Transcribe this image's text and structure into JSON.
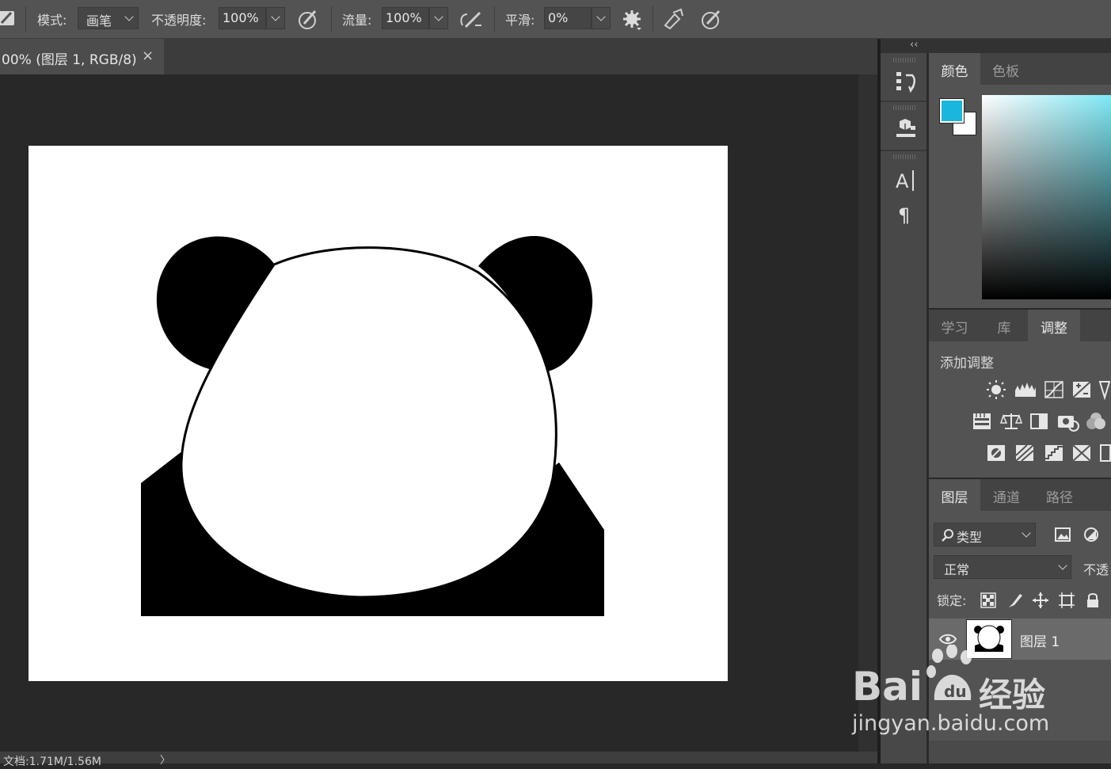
{
  "options_bar": {
    "mode_label": "模式:",
    "mode_value": "画笔",
    "opacity_label": "不透明度:",
    "opacity_value": "100%",
    "flow_label": "流量:",
    "flow_value": "100%",
    "smoothing_label": "平滑:",
    "smoothing_value": "0%"
  },
  "document": {
    "tab_title": "00% (图层 1, RGB/8)",
    "close_glyph": "×",
    "status": "文档:1.71M/1.56M",
    "status_arrow": "〉"
  },
  "dock": {
    "collapse_glyph": "‹‹"
  },
  "color_panel": {
    "tabs": [
      "颜色",
      "色板"
    ],
    "foreground": "#1ab6dd",
    "background": "#ffffff",
    "hue": "#7fe8f5"
  },
  "adjust_panel": {
    "tabs": [
      "学习",
      "库",
      "调整"
    ],
    "heading": "添加调整",
    "icons": [
      [
        "brightness-contrast-icon",
        "levels-icon",
        "curves-icon",
        "exposure-icon",
        "vibrance-icon"
      ],
      [
        "hue-saturation-icon",
        "color-balance-icon",
        "black-white-icon",
        "photo-filter-icon",
        "channel-mixer-icon"
      ],
      [
        "invert-icon",
        "posterize-icon",
        "threshold-icon",
        "selective-color-icon",
        "gradient-map-icon"
      ]
    ]
  },
  "layers_panel": {
    "tabs": [
      "图层",
      "通道",
      "路径"
    ],
    "filter_value": "类型",
    "blend_mode": "正常",
    "opacity_label": "不透",
    "lock_label": "锁定:",
    "layers": [
      {
        "name": "图层 1"
      }
    ]
  },
  "watermark": {
    "logo_text": "Bai",
    "logo_text_2": "经验",
    "url": "jingyan.baidu.com"
  }
}
